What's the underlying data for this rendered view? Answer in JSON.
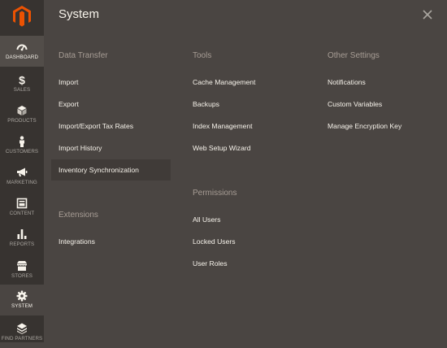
{
  "panel": {
    "title": "System"
  },
  "sidebar": {
    "items": [
      {
        "label": "DASHBOARD",
        "icon": "dashboard-icon"
      },
      {
        "label": "SALES",
        "icon": "dollar-icon"
      },
      {
        "label": "PRODUCTS",
        "icon": "cube-icon"
      },
      {
        "label": "CUSTOMERS",
        "icon": "person-icon"
      },
      {
        "label": "MARKETING",
        "icon": "megaphone-icon"
      },
      {
        "label": "CONTENT",
        "icon": "content-icon"
      },
      {
        "label": "REPORTS",
        "icon": "bar-chart-icon"
      },
      {
        "label": "STORES",
        "icon": "store-icon"
      },
      {
        "label": "SYSTEM",
        "icon": "gear-icon"
      },
      {
        "label": "FIND PARTNERS",
        "icon": "partners-icon"
      }
    ]
  },
  "sections": {
    "data_transfer": {
      "heading": "Data Transfer",
      "links": [
        "Import",
        "Export",
        "Import/Export Tax Rates",
        "Import History",
        "Inventory Synchronization"
      ]
    },
    "extensions": {
      "heading": "Extensions",
      "links": [
        "Integrations"
      ]
    },
    "tools": {
      "heading": "Tools",
      "links": [
        "Cache Management",
        "Backups",
        "Index Management",
        "Web Setup Wizard"
      ]
    },
    "permissions": {
      "heading": "Permissions",
      "links": [
        "All Users",
        "Locked Users",
        "User Roles"
      ]
    },
    "other_settings": {
      "heading": "Other Settings",
      "links": [
        "Notifications",
        "Custom Variables",
        "Manage Encryption Key"
      ]
    }
  },
  "colors": {
    "accent": "#eb5202",
    "panel_bg": "#4a4542",
    "sidebar_bg": "#373330",
    "heading": "#a79d95",
    "link": "#f7f3eb"
  }
}
